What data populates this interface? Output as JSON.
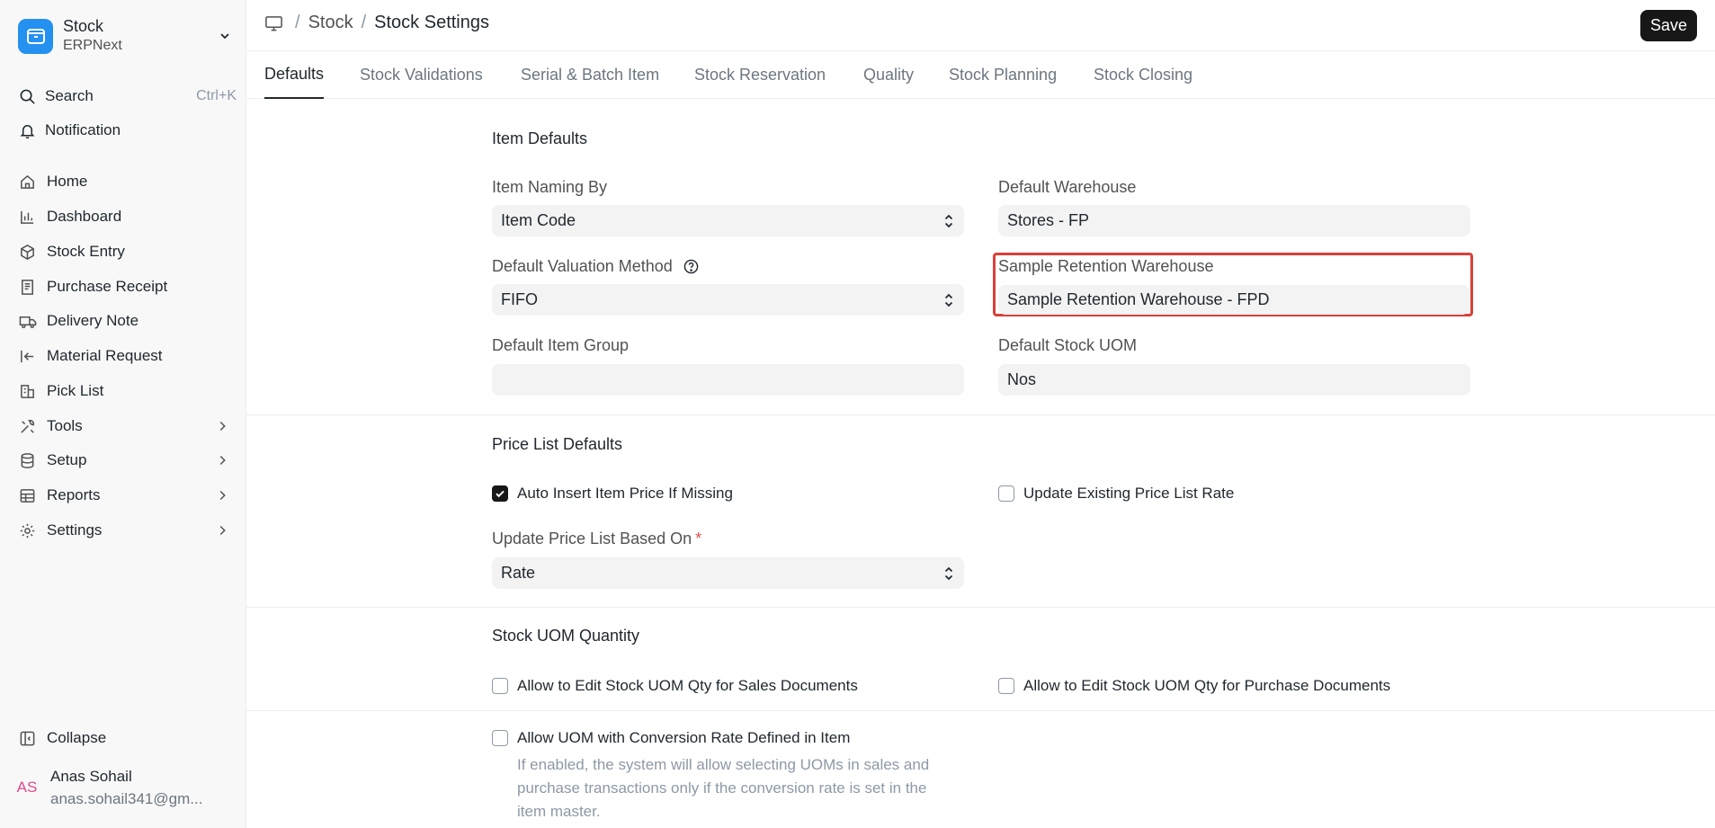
{
  "sidebar": {
    "app": {
      "name": "Stock",
      "subtitle": "ERPNext"
    },
    "search": {
      "label": "Search",
      "shortcut": "Ctrl+K"
    },
    "notification": {
      "label": "Notification"
    },
    "items": [
      {
        "label": "Home",
        "icon": "home-icon"
      },
      {
        "label": "Dashboard",
        "icon": "bar-chart-icon"
      },
      {
        "label": "Stock Entry",
        "icon": "cube-icon"
      },
      {
        "label": "Purchase Receipt",
        "icon": "receipt-icon"
      },
      {
        "label": "Delivery Note",
        "icon": "truck-icon"
      },
      {
        "label": "Material Request",
        "icon": "arrow-left-bar-icon"
      },
      {
        "label": "Pick List",
        "icon": "pick-list-icon"
      },
      {
        "label": "Tools",
        "icon": "tools-icon"
      },
      {
        "label": "Setup",
        "icon": "database-icon"
      },
      {
        "label": "Reports",
        "icon": "table-icon"
      },
      {
        "label": "Settings",
        "icon": "gear-icon"
      }
    ],
    "collapse": {
      "label": "Collapse"
    },
    "user": {
      "initials": "AS",
      "name": "Anas Sohail",
      "email": "anas.sohail341@gm..."
    }
  },
  "header": {
    "breadcrumb": {
      "parent": "Stock",
      "current": "Stock Settings",
      "sep": "/"
    },
    "save_label": "Save"
  },
  "tabs": [
    {
      "label": "Defaults",
      "active": true
    },
    {
      "label": "Stock Validations"
    },
    {
      "label": "Serial & Batch Item"
    },
    {
      "label": "Stock Reservation"
    },
    {
      "label": "Quality"
    },
    {
      "label": "Stock Planning"
    },
    {
      "label": "Stock Closing"
    }
  ],
  "sections": {
    "item_defaults": {
      "title": "Item Defaults",
      "item_naming_by": {
        "label": "Item Naming By",
        "value": "Item Code"
      },
      "default_warehouse": {
        "label": "Default Warehouse",
        "value": "Stores - FP"
      },
      "valuation_method": {
        "label": "Default Valuation Method",
        "value": "FIFO"
      },
      "sample_retention": {
        "label": "Sample Retention Warehouse",
        "value": "Sample Retention Warehouse - FPD"
      },
      "item_group": {
        "label": "Default Item Group",
        "value": ""
      },
      "stock_uom": {
        "label": "Default Stock UOM",
        "value": "Nos"
      }
    },
    "price_list": {
      "title": "Price List Defaults",
      "auto_insert": {
        "label": "Auto Insert Item Price If Missing",
        "checked": true
      },
      "update_existing": {
        "label": "Update Existing Price List Rate",
        "checked": false
      },
      "based_on": {
        "label": "Update Price List Based On",
        "required_mark": "*",
        "value": "Rate"
      }
    },
    "stock_uom_qty": {
      "title": "Stock UOM Quantity",
      "sales": {
        "label": "Allow to Edit Stock UOM Qty for Sales Documents",
        "checked": false
      },
      "purchase": {
        "label": "Allow to Edit Stock UOM Qty for Purchase Documents",
        "checked": false
      },
      "conversion": {
        "label": "Allow UOM with Conversion Rate Defined in Item",
        "checked": false
      },
      "help": "If enabled, the system will allow selecting UOMs in sales and purchase transactions only if the conversion rate is set in the item master."
    }
  },
  "colors": {
    "accent": "#2490ef",
    "highlight": "#d9403a",
    "primary_button": "#171717"
  }
}
